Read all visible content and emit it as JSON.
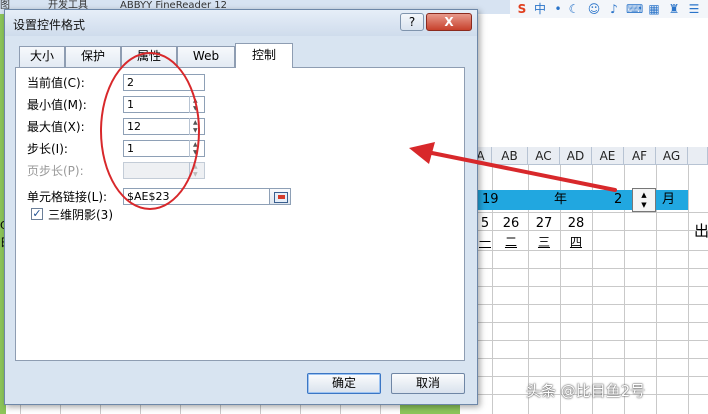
{
  "background": {
    "ribbon_tabs": [
      "图",
      "开发工具",
      "ABBYY FineReader 12"
    ],
    "toolbar_icons": [
      "sogou-logo-icon",
      "中",
      "dot-icon",
      "moon-icon",
      "smile-icon",
      "mic-icon",
      "keyboard-icon",
      "grid-icon",
      "shirt-icon",
      "menu-icon"
    ],
    "toolbar_zh": "中",
    "columns": [
      "A",
      "AB",
      "AC",
      "AD",
      "AE",
      "AF",
      "AG"
    ],
    "year_band": {
      "number": "19",
      "year_label": "年",
      "month_value": "2",
      "month_label": "月"
    },
    "days": [
      {
        "num": "5",
        "wk": "一"
      },
      {
        "num": "26",
        "wk": "二"
      },
      {
        "num": "27",
        "wk": "三"
      },
      {
        "num": "28",
        "wk": "四"
      }
    ],
    "right_char": "出",
    "left_char": "C",
    "left_char2": "日",
    "watermark": "头条 @比目鱼2号",
    "colors": {
      "band": "#21a7e0",
      "annotation": "#d8282b"
    }
  },
  "dialog": {
    "title": "设置控件格式",
    "help_label": "?",
    "close_label": "X",
    "tabs": [
      "大小",
      "保护",
      "属性",
      "Web",
      "控制"
    ],
    "active_tab": "控制",
    "fields": {
      "current_value": {
        "label": "当前值(C):",
        "value": "2"
      },
      "min_value": {
        "label": "最小值(M):",
        "value": "1"
      },
      "max_value": {
        "label": "最大值(X):",
        "value": "12"
      },
      "step": {
        "label": "步长(I):",
        "value": "1"
      },
      "page_step": {
        "label": "页步长(P):",
        "value": ""
      },
      "cell_link": {
        "label": "单元格链接(L):",
        "value": "$AE$23"
      }
    },
    "shading": {
      "label": "三维阴影(3)",
      "checked": true,
      "mark": "✓"
    },
    "ok_label": "确定",
    "cancel_label": "取消"
  }
}
